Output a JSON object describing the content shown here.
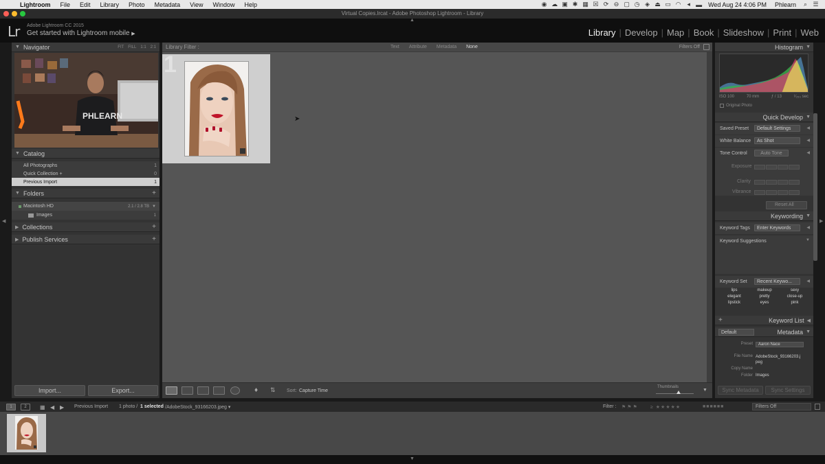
{
  "menubar": {
    "app": "Lightroom",
    "items": [
      "File",
      "Edit",
      "Library",
      "Photo",
      "Metadata",
      "View",
      "Window",
      "Help"
    ],
    "clock": "Wed Aug 24  4:06 PM",
    "user": "Phlearn"
  },
  "window": {
    "title": "Virtual Copies.lrcat - Adobe Photoshop Lightroom - Library"
  },
  "identity": {
    "logo": "Lr",
    "version": "Adobe Lightroom CC 2015",
    "mobile": "Get started with Lightroom mobile",
    "mobile_arrow": "▶"
  },
  "modules": [
    "Library",
    "Develop",
    "Map",
    "Book",
    "Slideshow",
    "Print",
    "Web"
  ],
  "navigator": {
    "title": "Navigator",
    "zoom": [
      "FIT",
      "FILL",
      "1:1",
      "2:1"
    ]
  },
  "catalog": {
    "title": "Catalog",
    "items": [
      {
        "label": "All Photographs",
        "count": "1"
      },
      {
        "label": "Quick Collection +",
        "count": "0"
      },
      {
        "label": "Previous Import",
        "count": "1"
      }
    ]
  },
  "folders": {
    "title": "Folders",
    "drive": {
      "label": "Macintosh HD",
      "meta": "2.1 / 2.8 TB"
    },
    "items": [
      {
        "label": "Images",
        "count": "1"
      }
    ]
  },
  "collections": {
    "title": "Collections"
  },
  "publish": {
    "title": "Publish Services"
  },
  "left_buttons": {
    "import": "Import...",
    "export": "Export..."
  },
  "filter": {
    "label": "Library Filter :",
    "options": [
      "Text",
      "Attribute",
      "Metadata",
      "None"
    ],
    "state": "Filters Off"
  },
  "grid": {
    "index": "1"
  },
  "toolbar": {
    "sort_label": "Sort:",
    "sort_value": "Capture Time",
    "thumbnails": "Thumbnails"
  },
  "histogram": {
    "title": "Histogram",
    "iso": "ISO 100",
    "focal": "70 mm",
    "aperture": "ƒ / 13",
    "shutter": "¹⁄₂₅₀ sec",
    "original": "Original Photo"
  },
  "quick_develop": {
    "title": "Quick Develop",
    "saved_preset_label": "Saved Preset",
    "saved_preset_value": "Default Settings",
    "wb_label": "White Balance",
    "wb_value": "As Shot",
    "tone_label": "Tone Control",
    "auto_tone": "Auto Tone",
    "exposure": "Exposure",
    "clarity": "Clarity",
    "vibrance": "Vibrance",
    "reset": "Reset All"
  },
  "keywording": {
    "title": "Keywording",
    "tags_label": "Keyword Tags",
    "tags_value": "Enter Keywords",
    "suggestions": "Keyword Suggestions",
    "set_label": "Keyword Set",
    "set_value": "Recent Keywo...",
    "keywords": [
      "lips",
      "makeup",
      "sexy",
      "elegant",
      "pretty",
      "close-up",
      "lipstick",
      "eyes",
      "pink"
    ]
  },
  "keyword_list": {
    "title": "Keyword List"
  },
  "metadata": {
    "title": "Metadata",
    "preset_select": "Default",
    "preset_label": "Preset",
    "preset_value": "Aaron Nace",
    "file_name_label": "File Name",
    "file_name_value": "AdobeStock_93166203.jpeg",
    "copy_name_label": "Copy Name",
    "folder_label": "Folder",
    "folder_value": "Images"
  },
  "sync": {
    "metadata": "Sync Metadata",
    "settings": "Sync Settings"
  },
  "filmstrip": {
    "screen1": "1",
    "screen2": "2",
    "source": "Previous Import",
    "count_prefix": "1 photo /",
    "selected": "1 selected",
    "file": "/AdobeStock_93166203.jpeg ▾",
    "filter_label": "Filter :",
    "filter_state": "Filters Off"
  },
  "colors": {
    "panel": "#333333",
    "canvas": "#555555",
    "selected_row": "#cfcfcf"
  }
}
